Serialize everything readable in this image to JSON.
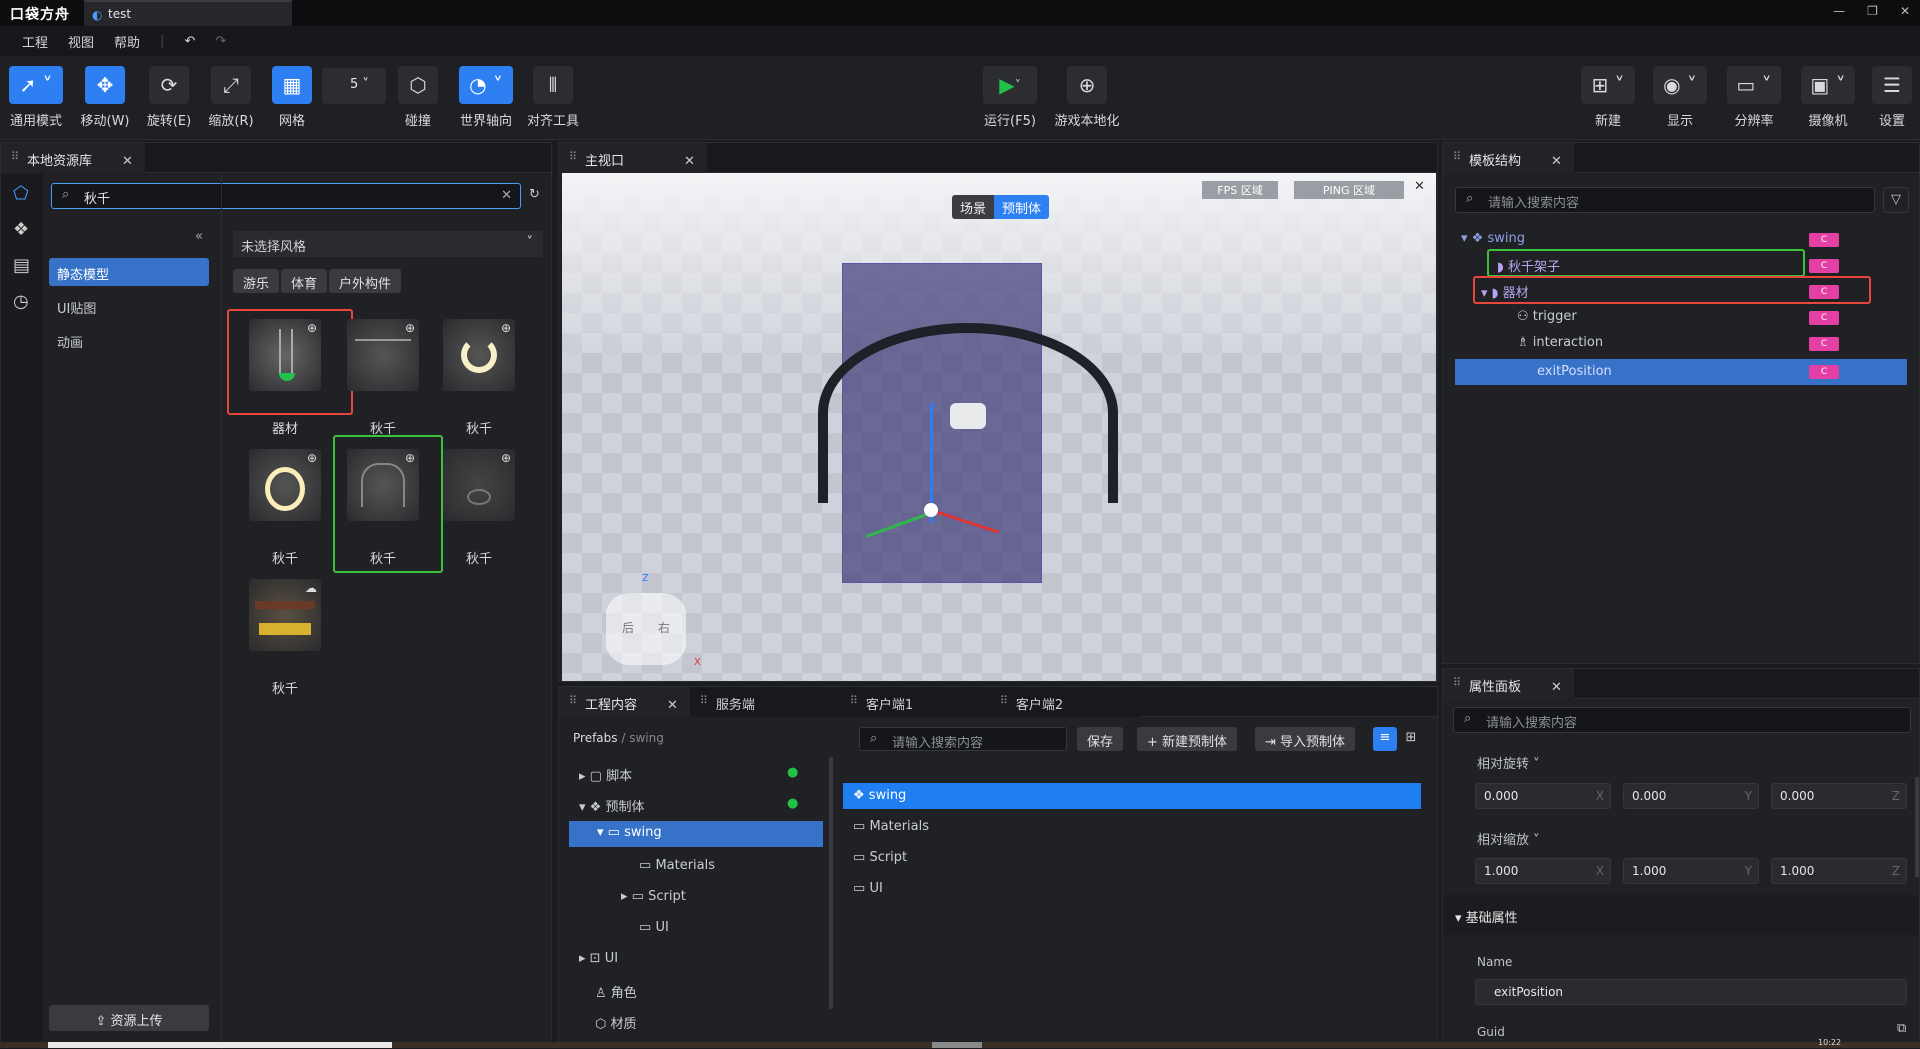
{
  "app": {
    "logo": "口袋方舟",
    "tab": "test"
  },
  "menu": [
    "工程",
    "视图",
    "帮助"
  ],
  "toolbar": {
    "general": "通用模式",
    "move": "移动(W)",
    "rotate": "旋转(E)",
    "scale": "缩放(R)",
    "grid": "网格",
    "grid_size": "5",
    "collision": "碰撞",
    "world_axis": "世界轴向",
    "align": "对齐工具",
    "run": "运行(F5)",
    "localize": "游戏本地化",
    "new": "新建",
    "display": "显示",
    "resolution": "分辨率",
    "camera": "摄像机",
    "settings": "设置"
  },
  "assets": {
    "tab": "本地资源库",
    "search_value": "秋千",
    "style_select": "未选择风格",
    "categories": [
      "静态模型",
      "UI贴图",
      "动画"
    ],
    "tags": [
      "游乐",
      "体育",
      "户外构件"
    ],
    "items": [
      "器材",
      "秋千",
      "秋千",
      "秋千",
      "秋千",
      "秋千",
      "秋千"
    ],
    "upload": "资源上传"
  },
  "viewport": {
    "tab": "主视口",
    "mode_scene": "场景",
    "mode_prefab": "预制体",
    "fps": "FPS 区域",
    "ping": "PING 区域",
    "gizmo_left": "后",
    "gizmo_right": "右",
    "axis_z": "Z",
    "axis_x": "X"
  },
  "project": {
    "tabs": [
      "工程内容",
      "服务端",
      "客户端1",
      "客户端2"
    ],
    "breadcrumb_root": "Prefabs",
    "breadcrumb_sep": "/",
    "breadcrumb_leaf": "swing",
    "search_placeholder": "请输入搜索内容",
    "save": "保存",
    "new_prefab": "新建预制体",
    "import_prefab": "导入预制体",
    "tree": [
      "脚本",
      "预制体",
      "swing",
      "Materials",
      "Script",
      "UI",
      "UI",
      "角色",
      "材质"
    ],
    "files": [
      "swing",
      "Materials",
      "Script",
      "UI"
    ]
  },
  "hierarchy": {
    "tab": "模板结构",
    "search_placeholder": "请输入搜索内容",
    "nodes": [
      "swing",
      "秋千架子",
      "器材",
      "trigger",
      "interaction",
      "exitPosition"
    ],
    "badge": "C"
  },
  "properties": {
    "tab": "属性面板",
    "search_placeholder": "请输入搜索内容",
    "rel_rotation": "相对旋转",
    "rot": [
      "0.000",
      "0.000",
      "0.000"
    ],
    "rel_scale": "相对缩放",
    "scale": [
      "1.000",
      "1.000",
      "1.000"
    ],
    "axes": [
      "X",
      "Y",
      "Z"
    ],
    "basic": "基础属性",
    "name_label": "Name",
    "name_value": "exitPosition",
    "guid_label": "Guid"
  },
  "status": {
    "time": "10:22"
  },
  "colors": {
    "accent": "#2d7ff2",
    "badge": "#e33fa5",
    "red_box": "#e8453c",
    "green_box": "#3cc13b"
  }
}
